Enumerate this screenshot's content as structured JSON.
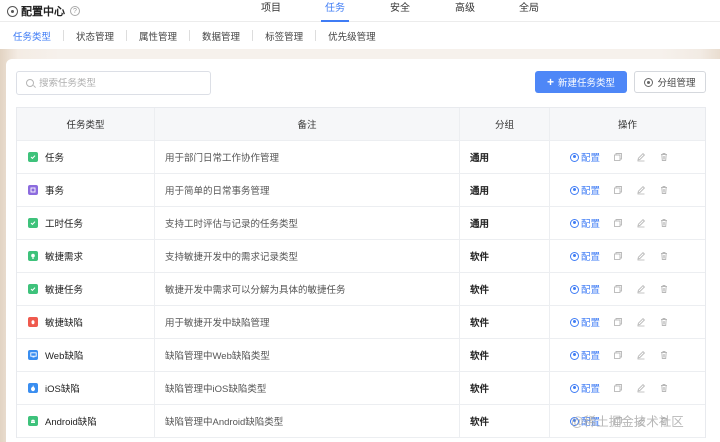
{
  "app": {
    "title": "配置中心",
    "help_glyph": "?"
  },
  "top_nav": {
    "items": [
      {
        "label": "项目",
        "active": false
      },
      {
        "label": "任务",
        "active": true
      },
      {
        "label": "安全",
        "active": false
      },
      {
        "label": "高级",
        "active": false
      },
      {
        "label": "全局",
        "active": false
      }
    ]
  },
  "sub_nav": {
    "items": [
      {
        "label": "任务类型",
        "active": true
      },
      {
        "label": "状态管理",
        "active": false
      },
      {
        "label": "属性管理",
        "active": false
      },
      {
        "label": "数据管理",
        "active": false
      },
      {
        "label": "标签管理",
        "active": false
      },
      {
        "label": "优先级管理",
        "active": false
      }
    ]
  },
  "toolbar": {
    "search_placeholder": "搜索任务类型",
    "new_button": "新建任务类型",
    "group_button": "分组管理"
  },
  "table": {
    "headers": [
      "任务类型",
      "备注",
      "分组",
      "操作"
    ],
    "config_label": "配置",
    "rows": [
      {
        "name": "任务",
        "note": "用于部门日常工作协作管理",
        "group": "通用",
        "icon": "task-icon",
        "color": "#3ec27b"
      },
      {
        "name": "事务",
        "note": "用于简单的日常事务管理",
        "group": "通用",
        "icon": "affair-icon",
        "color": "#8c6bde"
      },
      {
        "name": "工时任务",
        "note": "支持工时评估与记录的任务类型",
        "group": "通用",
        "icon": "timesheet-task-icon",
        "color": "#3ec27b"
      },
      {
        "name": "敏捷需求",
        "note": "支持敏捷开发中的需求记录类型",
        "group": "软件",
        "icon": "bulb-icon",
        "color": "#3ec27b"
      },
      {
        "name": "敏捷任务",
        "note": "敏捷开发中需求可以分解为具体的敏捷任务",
        "group": "软件",
        "icon": "agile-task-icon",
        "color": "#3ec27b"
      },
      {
        "name": "敏捷缺陷",
        "note": "用于敏捷开发中缺陷管理",
        "group": "软件",
        "icon": "bug-icon",
        "color": "#ef5a4e"
      },
      {
        "name": "Web缺陷",
        "note": "缺陷管理中Web缺陷类型",
        "group": "软件",
        "icon": "monitor-icon",
        "color": "#3a8ef0"
      },
      {
        "name": "iOS缺陷",
        "note": "缺陷管理中iOS缺陷类型",
        "group": "软件",
        "icon": "apple-icon",
        "color": "#3a8ef0"
      },
      {
        "name": "Android缺陷",
        "note": "缺陷管理中Android缺陷类型",
        "group": "软件",
        "icon": "android-icon",
        "color": "#3ec27b"
      }
    ]
  },
  "colors": {
    "accent": "#3f7cf5",
    "primary_button": "#4e87f7"
  },
  "watermark": "@稀土掘金技术社区"
}
